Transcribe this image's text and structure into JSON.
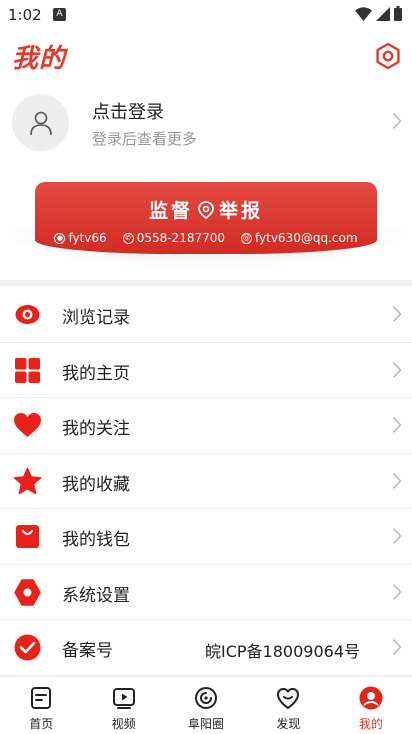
{
  "status_bar": {
    "time": "1:02",
    "a_badge": "A"
  },
  "header": {
    "title": "我的"
  },
  "login": {
    "title": "点击登录",
    "subtitle": "登录后查看更多"
  },
  "banner": {
    "title_left": "监督",
    "title_right": "举报",
    "wechat": "fytv66",
    "phone": "0558-2187700",
    "email": "fytv630@qq.com"
  },
  "menu": [
    {
      "label": "浏览记录",
      "icon": "history-icon",
      "value": ""
    },
    {
      "label": "我的主页",
      "icon": "grid-icon",
      "value": ""
    },
    {
      "label": "我的关注",
      "icon": "heart-icon",
      "value": ""
    },
    {
      "label": "我的收藏",
      "icon": "star-icon",
      "value": ""
    },
    {
      "label": "我的钱包",
      "icon": "wallet-icon",
      "value": ""
    },
    {
      "label": "系统设置",
      "icon": "settings-icon",
      "value": ""
    },
    {
      "label": "备案号",
      "icon": "check-icon",
      "value": "皖ICP备18009064号"
    }
  ],
  "tabs": [
    {
      "label": "首页",
      "icon": "home-icon"
    },
    {
      "label": "视频",
      "icon": "video-icon"
    },
    {
      "label": "阜阳圈",
      "icon": "circle-icon"
    },
    {
      "label": "发现",
      "icon": "discover-icon"
    },
    {
      "label": "我的",
      "icon": "profile-icon",
      "active": true
    }
  ],
  "colors": {
    "accent": "#e23a2d",
    "muted": "#999999",
    "divider": "#eeeeee"
  }
}
